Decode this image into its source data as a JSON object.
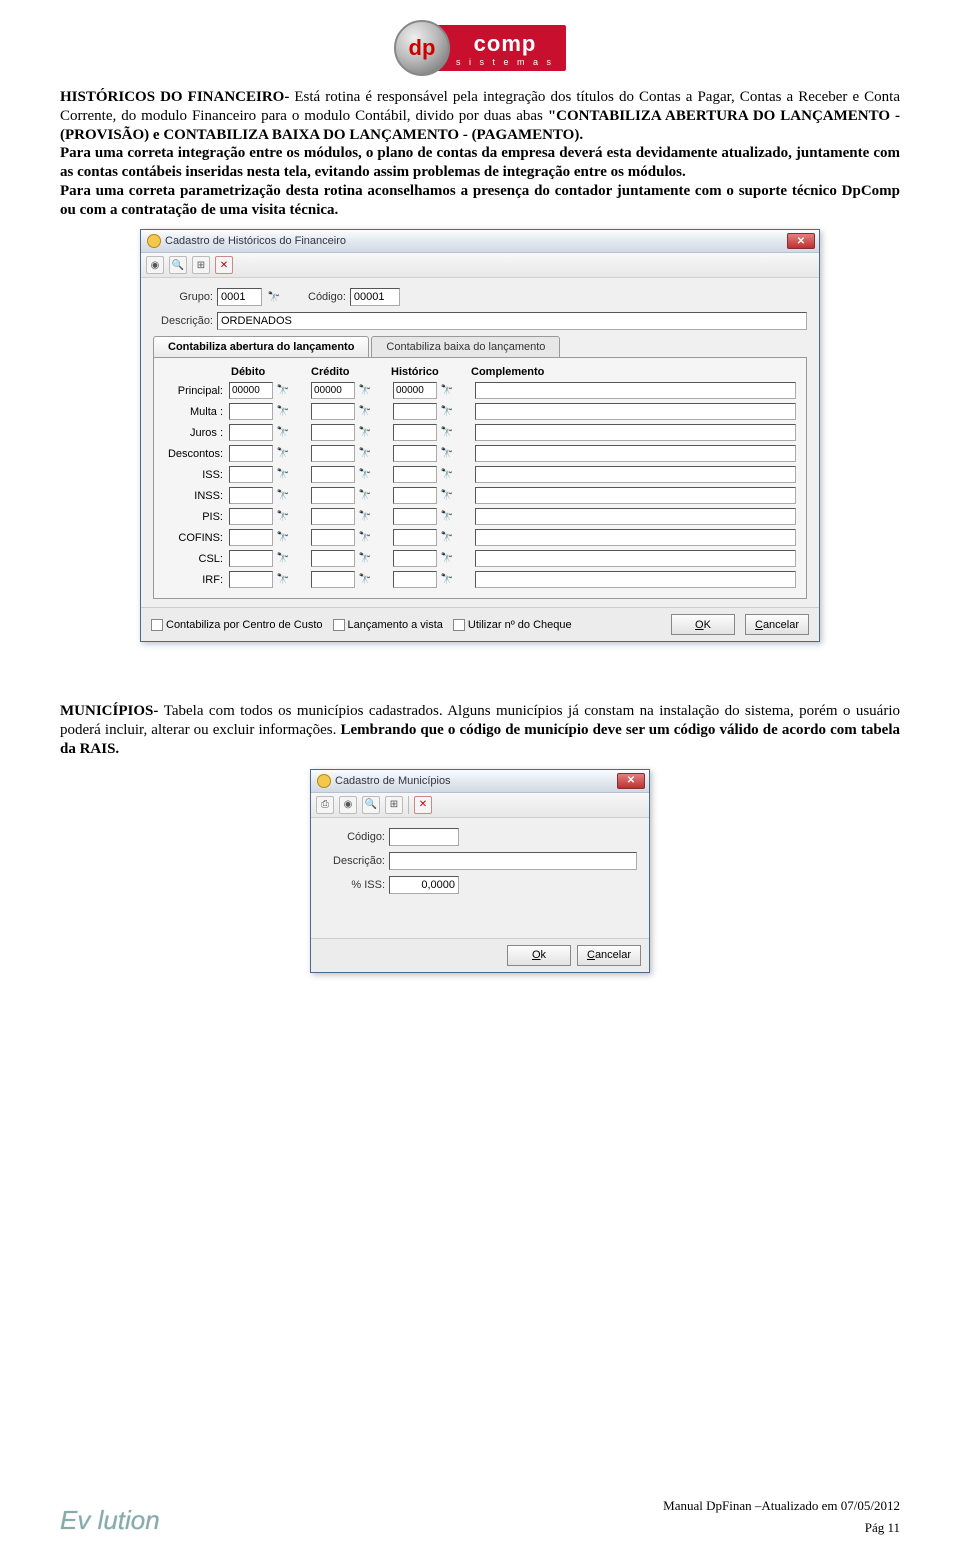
{
  "logo": {
    "dp": "dp",
    "comp": "comp",
    "sub": "s i s t e m a s"
  },
  "para1_a": "HISTÓRICOS DO FINANCEIRO- ",
  "para1_b": "Está rotina é responsável pela integração dos títulos do Contas a Pagar, Contas a Receber e Conta Corrente, do modulo Financeiro para o modulo Contábil, divido por duas abas ",
  "para1_c": "\"CONTABILIZA ABERTURA DO LANÇAMENTO - (PROVISÃO) e CONTABILIZA BAIXA DO LANÇAMENTO - (PAGAMENTO).",
  "para2": "Para uma correta integração entre os módulos, o plano de contas da empresa deverá esta devidamente atualizado, juntamente com as contas contábeis inseridas nesta tela, evitando assim problemas de integração entre os módulos.",
  "para3": "Para uma correta parametrização desta rotina aconselhamos a presença do contador juntamente com o suporte técnico DpComp ou com a contratação de uma visita técnica.",
  "win1": {
    "title": "Cadastro de Históricos do Financeiro",
    "grupo_lbl": "Grupo:",
    "grupo": "0001",
    "codigo_lbl": "Código:",
    "codigo": "00001",
    "descricao_lbl": "Descrição:",
    "descricao": "ORDENADOS",
    "tab1": "Contabiliza abertura do lançamento",
    "tab2": "Contabiliza baixa do lançamento",
    "headers": {
      "debito": "Débito",
      "credito": "Crédito",
      "historico": "Histórico",
      "complemento": "Complemento"
    },
    "rows": [
      {
        "label": "Principal:",
        "deb": "00000",
        "cred": "00000",
        "hist": "00000"
      },
      {
        "label": "Multa :",
        "deb": "",
        "cred": "",
        "hist": ""
      },
      {
        "label": "Juros :",
        "deb": "",
        "cred": "",
        "hist": ""
      },
      {
        "label": "Descontos:",
        "deb": "",
        "cred": "",
        "hist": ""
      },
      {
        "label": "ISS:",
        "deb": "",
        "cred": "",
        "hist": ""
      },
      {
        "label": "INSS:",
        "deb": "",
        "cred": "",
        "hist": ""
      },
      {
        "label": "PIS:",
        "deb": "",
        "cred": "",
        "hist": ""
      },
      {
        "label": "COFINS:",
        "deb": "",
        "cred": "",
        "hist": ""
      },
      {
        "label": "CSL:",
        "deb": "",
        "cred": "",
        "hist": ""
      },
      {
        "label": "IRF:",
        "deb": "",
        "cred": "",
        "hist": ""
      }
    ],
    "chk1": "Contabiliza por Centro de Custo",
    "chk2": "Lançamento a vista",
    "chk3": "Utilizar nº do Cheque",
    "ok": "OK",
    "cancel": "Cancelar"
  },
  "para4_a": "MUNICÍPIOS- ",
  "para4_b": "Tabela com todos os municípios cadastrados. Alguns municípios já constam na instalação do sistema, porém o usuário poderá incluir, alterar ou excluir informações. ",
  "para4_c": "Lembrando que o código de município deve ser um código válido de acordo com tabela da RAIS.",
  "win2": {
    "title": "Cadastro de Municípios",
    "codigo_lbl": "Código:",
    "descricao_lbl": "Descrição:",
    "iss_lbl": "% ISS:",
    "iss": "0,0000",
    "ok": "Ok",
    "cancel": "Cancelar"
  },
  "footer": {
    "evolution": "Ev   lution",
    "manual": "Manual DpFinan –Atualizado em 07/05/2012",
    "page": "Pág 11"
  }
}
